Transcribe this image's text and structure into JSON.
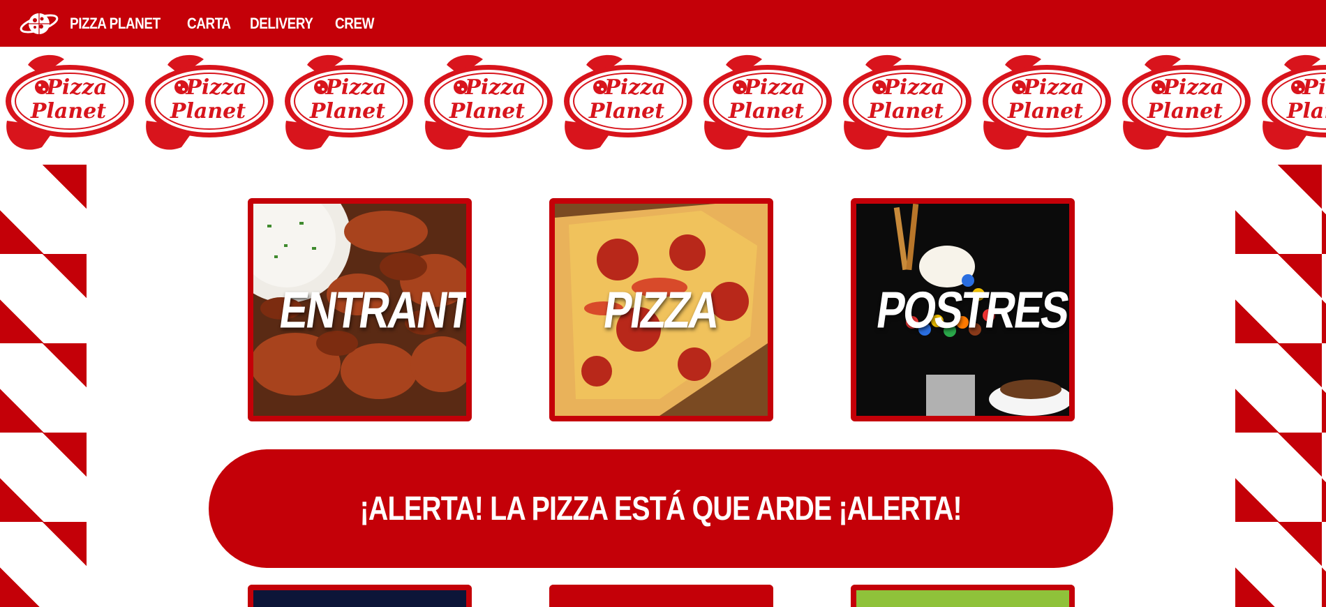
{
  "nav": {
    "logo_icon": "planet-pizza-logo-icon",
    "links": [
      "PIZZA PLANET",
      "CARTA",
      "DELIVERY",
      "CREW"
    ]
  },
  "banner": {
    "logo_line1": "Pizza",
    "logo_line2": "Planet",
    "repeat_count": 10
  },
  "categories": [
    {
      "title": "ENTRANTES",
      "image": "chicken-wings-with-dip"
    },
    {
      "title": "PIZZA",
      "image": "pepperoni-pizza-slices"
    },
    {
      "title": "POSTRES",
      "image": "candy-milkshake"
    }
  ],
  "alert": {
    "text": "¡ALERTA! LA PIZZA ESTÁ QUE ARDE ¡ALERTA!"
  },
  "bottom_cards": [
    "space-image",
    "red-card",
    "green-aliens-image"
  ],
  "colors": {
    "brand_red": "#c40008",
    "white": "#ffffff"
  }
}
